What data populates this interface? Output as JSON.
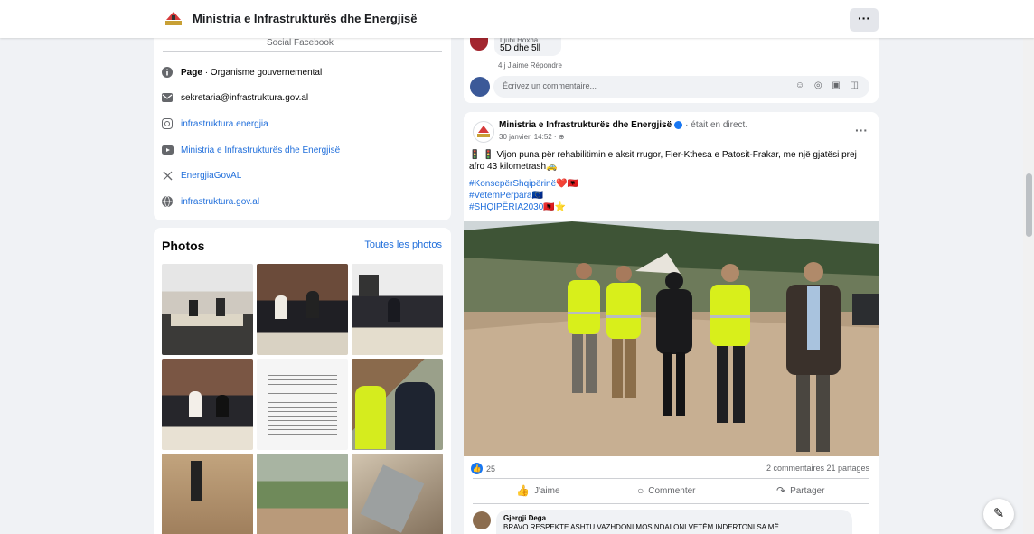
{
  "topbar": {
    "title": "Ministria e Infrastrukturës dhe Energjisë",
    "more_label": "···"
  },
  "intro": {
    "cut_text": "Social Facebook",
    "category_label": "Page",
    "category_value": "· Organisme gouvernemental",
    "email": "sekretaria@infrastruktura.gov.al",
    "instagram": "infrastruktura.energjia",
    "youtube": "Ministria e Infrastrukturës dhe Energjisë",
    "twitter": "EnergjiaGovAL",
    "website": "infrastruktura.gov.al"
  },
  "photos": {
    "title": "Photos",
    "see_all": "Toutes les photos"
  },
  "post0": {
    "commenter": "Ljubi Hoxha",
    "comment": "5D dhe 5ll",
    "actions": "4 j   J'aime   Répondre",
    "comment_placeholder": "Écrivez un commentaire...",
    "comment_icons": "☺ ◎ ▣ ◫"
  },
  "post": {
    "author": "Ministria e Infrastrukturës dhe Energjisë",
    "live": "· était en direct.",
    "date": "30 janvier, 14:52 · ⊕",
    "more": "···",
    "text": "🚦 🚦 Vijon puna për rehabilitimin e aksit rrugor, Fier-Kthesa e Patosit-Frakar, me një gjatësi prej afro 43 kilometrash🚕",
    "hashtag1": "#KonsepërShqipërinë❤️🇦🇱",
    "hashtag2": "#VetëmPërpara🇪🇺",
    "hashtag3": "#SHQIPËRIA2030🇦🇱⭐",
    "reactions": "25",
    "stats": "2 commentaires   21 partages",
    "like_label": "J'aime",
    "comment_label": "Commenter",
    "share_label": "Partager",
    "commenter_name": "Gjergji Dega",
    "comment_text": "BRAVO RESPEKTE ASHTU VAZHDONI MOS NDALONI VETËM INDERTONI SA MË"
  },
  "colors": {
    "accent": "#1877f2",
    "link": "#216fdb",
    "background": "#f0f2f5",
    "vest": "#d8ef1b"
  }
}
